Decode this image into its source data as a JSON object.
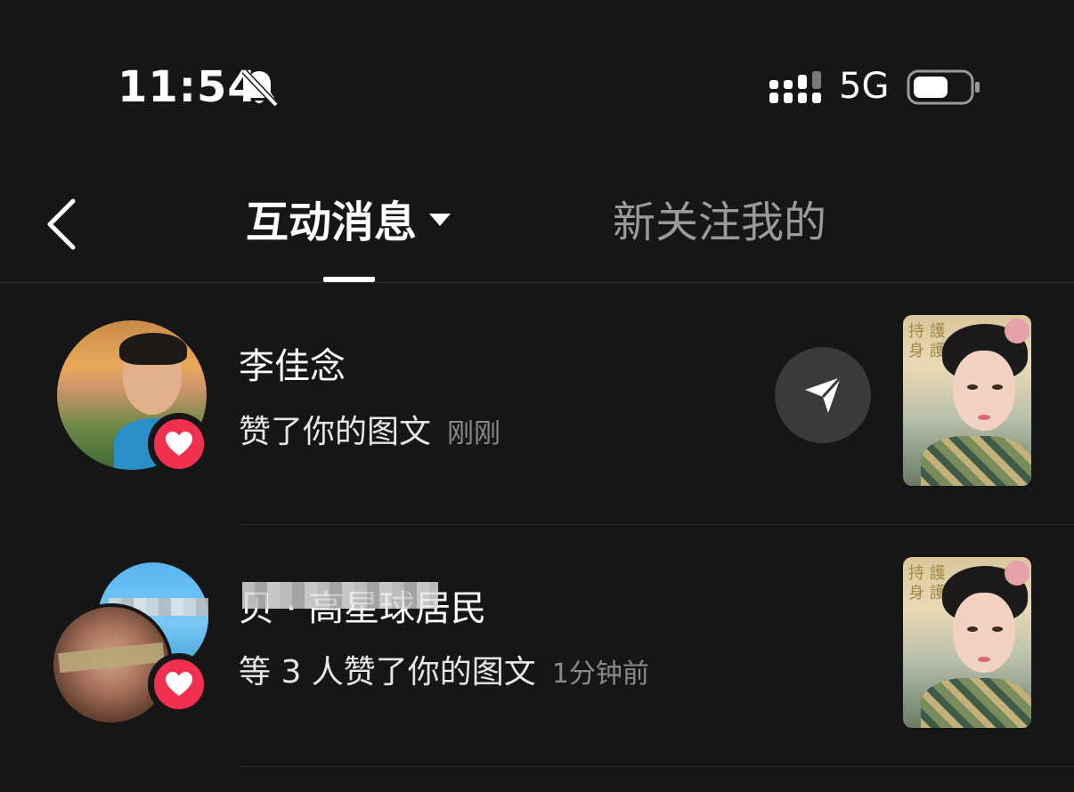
{
  "status_bar": {
    "time": "11:54",
    "network": "5G",
    "icons": [
      "bell-muted-icon",
      "signal-icon",
      "battery-icon"
    ]
  },
  "header": {
    "back_icon": "chevron-left-icon",
    "tabs": [
      {
        "label": "互动消息",
        "active": true,
        "has_dropdown": true
      },
      {
        "label": "新关注我的",
        "active": false
      }
    ]
  },
  "notifications": [
    {
      "name": "李佳念",
      "action": "赞了你的图文",
      "time": "刚刚",
      "badge_icon": "heart-icon",
      "action_icon": "send-icon"
    },
    {
      "name": "贝 · 高星球居民",
      "action": "等 3 人赞了你的图文",
      "time": "1分钟前",
      "badge_icon": "heart-icon"
    }
  ],
  "colors": {
    "background": "#161616",
    "like_badge": "#f0304e",
    "active_tab": "#ffffff",
    "inactive_tab": "#9a9a9a",
    "secondary_text": "#8a8a8a"
  }
}
